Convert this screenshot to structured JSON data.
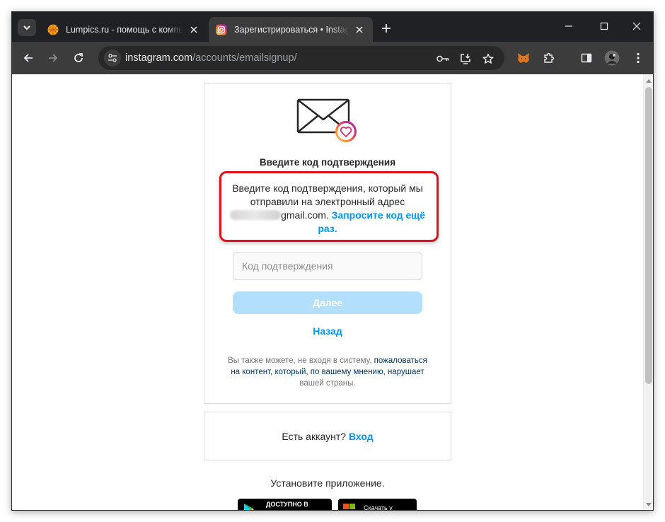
{
  "browser": {
    "tabs": [
      {
        "title": "Lumpics.ru - помощь с компьютером",
        "active": false,
        "favicon": "lumpics-orange-circle"
      },
      {
        "title": "Зарегистрироваться • Instagram",
        "active": true,
        "favicon": "instagram-logo"
      }
    ],
    "url_host": "instagram.com",
    "url_path": "/accounts/emailsignup/"
  },
  "page": {
    "heading": "Введите код подтверждения",
    "description_line": "Введите код подтверждения, который мы отправили на электронный адрес",
    "email_visible": "gmail.com.",
    "resend_link": "Запросите код ещё раз.",
    "code_placeholder": "Код подтверждения",
    "next_button": "Далее",
    "back_link": "Назад",
    "footnote_prefix": "Вы также можете, не входя в систему,",
    "footnote_link": "пожаловаться на контент, который, по вашему мнению, нарушает",
    "footnote_suffix": "вашей страны.",
    "login_prompt": "Есть аккаунт?",
    "login_link": "Вход",
    "install_text": "Установите приложение.",
    "badge_google": "ДОСТУПНО В",
    "badge_microsoft": "Скачать у"
  },
  "colors": {
    "accent_blue": "#0095f6",
    "highlight_red": "#e0101c",
    "disabled_button": "#b2dffc"
  }
}
